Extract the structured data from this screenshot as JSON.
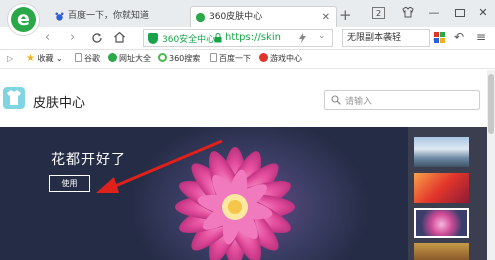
{
  "browser": {
    "tabs": [
      {
        "label": "百度一下，你就知道"
      },
      {
        "label": "360皮肤中心"
      }
    ],
    "new_tab_symbol": "+",
    "window_controls": {
      "badge": "2",
      "minimize": "—",
      "close": "✕"
    },
    "address": {
      "security_label": "360安全中心",
      "url": "https://skin"
    },
    "search_text": "无限副本袭轻",
    "bookmarks": [
      {
        "label": "收藏",
        "icon": "star-icon",
        "color": "#f0b21b"
      },
      {
        "label": "谷歌",
        "icon": "page-icon",
        "color": "#999999"
      },
      {
        "label": "网址大全",
        "icon": "globe-icon",
        "color": "#2aa84a"
      },
      {
        "label": "360搜索",
        "icon": "search-icon",
        "color": "#4fb84a"
      },
      {
        "label": "百度一下",
        "icon": "page-icon",
        "color": "#999999"
      },
      {
        "label": "游戏中心",
        "icon": "game-icon",
        "color": "#e0332a"
      }
    ]
  },
  "page": {
    "title": "皮肤中心",
    "search_placeholder": "请输入",
    "banner": {
      "title": "花都开好了",
      "button_label": "使用"
    }
  },
  "colors": {
    "accent_green": "#19a34a",
    "annotation_arrow": "#e0201a"
  }
}
